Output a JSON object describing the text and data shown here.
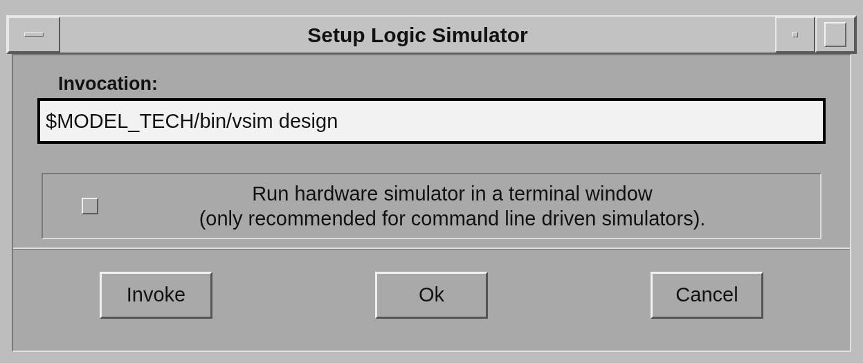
{
  "window": {
    "title": "Setup Logic Simulator"
  },
  "invocation": {
    "label": "Invocation:",
    "value": "$MODEL_TECH/bin/vsim design"
  },
  "terminal_option": {
    "checked": false,
    "label_lines": [
      "Run hardware simulator in a terminal window",
      "(only recommended for command line driven simulators)."
    ]
  },
  "buttons": [
    "Invoke",
    "Ok",
    "Cancel"
  ]
}
